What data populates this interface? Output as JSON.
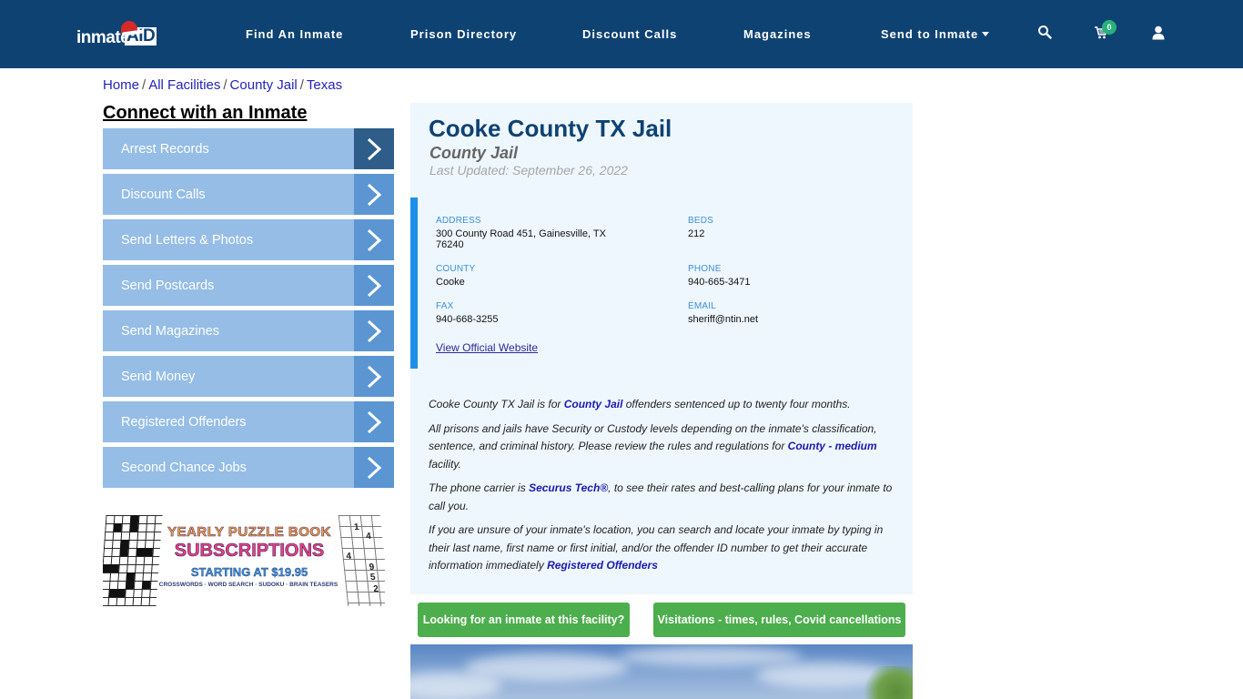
{
  "navbar": {
    "logo": {
      "text": "inmate",
      "accent": "AID"
    },
    "links": [
      {
        "label": "Find An Inmate"
      },
      {
        "label": "Prison Directory"
      },
      {
        "label": "Discount Calls"
      },
      {
        "label": "Magazines"
      },
      {
        "label": "Send to Inmate",
        "has_dropdown": true
      }
    ],
    "icons": {
      "search": "search-icon",
      "cart": "cart-icon",
      "user": "user-icon"
    },
    "cart_count": "0",
    "colors": {
      "background": "#0e4272",
      "badge": "#27b07a"
    }
  },
  "breadcrumb": [
    {
      "label": "Home"
    },
    {
      "label": "All Facilities"
    },
    {
      "label": "County Jail"
    },
    {
      "label": "Texas"
    }
  ],
  "breadcrumb_separator": "/",
  "sidebar": {
    "title": "Connect with an Inmate",
    "items": [
      {
        "label": "Arrest Records",
        "active": true
      },
      {
        "label": "Discount Calls"
      },
      {
        "label": "Send Letters & Photos"
      },
      {
        "label": "Send Postcards"
      },
      {
        "label": "Send Magazines"
      },
      {
        "label": "Send Money"
      },
      {
        "label": "Registered Offenders"
      },
      {
        "label": "Second Chance Jobs"
      }
    ],
    "ad": {
      "line1": "YEARLY PUZZLE BOOK",
      "line2": "SUBSCRIPTIONS",
      "line3": "STARTING AT $19.95",
      "line4": "CROSSWORDS · WORD SEARCH · SUDOKU · BRAIN TEASERS",
      "sudoku_numbers": [
        "1",
        "4",
        "4",
        "9",
        "5",
        "2"
      ]
    },
    "colors": {
      "item": "#95bde6",
      "arrow": "#5b96d3",
      "arrow_active": "#2e5d8a"
    }
  },
  "facility": {
    "name": "Cooke County TX Jail",
    "type": "County Jail",
    "last_updated": "Last Updated: September 26, 2022",
    "fields": {
      "address": {
        "label": "ADDRESS",
        "value": "300 County Road 451, Gainesville, TX 76240"
      },
      "beds": {
        "label": "BEDS",
        "value": "212"
      },
      "county": {
        "label": "COUNTY",
        "value": "Cooke"
      },
      "phone": {
        "label": "PHONE",
        "value": "940-665-3471"
      },
      "fax": {
        "label": "FAX",
        "value": "940-668-3255"
      },
      "email": {
        "label": "EMAIL",
        "value": "sheriff@ntin.net"
      }
    },
    "website_link": "View Official Website",
    "description": {
      "p1": {
        "a": "Cooke County TX Jail is for ",
        "link": "County Jail",
        "b": " offenders sentenced up to twenty four months."
      },
      "p2": {
        "a": "All prisons and jails have Security or Custody levels depending on the inmate's classification, sentence, and criminal history. Please review the rules and regulations for ",
        "link": "County - medium",
        "b": " facility."
      },
      "p3": {
        "a": "The phone carrier is ",
        "link": "Securus Tech®",
        "b": ", to see their rates and best-calling plans for your inmate to call you."
      },
      "p4": {
        "a": "If you are unsure of your inmate's location, you can search and locate your inmate by typing in their last name, first name or first initial, and/or the offender ID number to get their accurate information immediately ",
        "link": "Registered Offenders",
        "b": ""
      }
    },
    "colors": {
      "title": "#0e4272",
      "panel": "#eef7fd",
      "accent_bar": "#1c8fe8",
      "field_label": "#3d8fd8"
    }
  },
  "actions": {
    "find_inmate": "Looking for an inmate at this facility?",
    "visitations": "Visitations - times, rules, Covid cancellations",
    "color": "#4cae4c"
  }
}
